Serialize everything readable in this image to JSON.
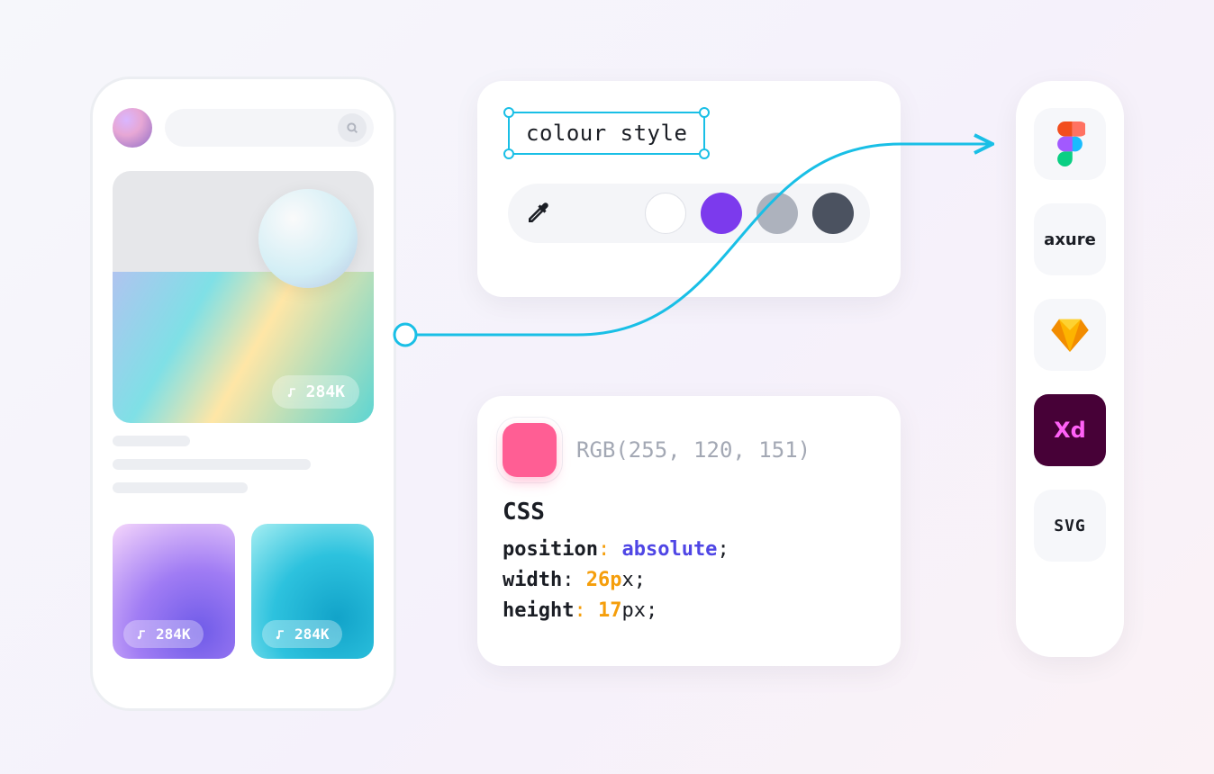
{
  "phone": {
    "hero_count": "284K",
    "thumb1_count": "284K",
    "thumb2_count": "284K"
  },
  "style_panel": {
    "field_label": "colour style",
    "swatches": {
      "white": "#ffffff",
      "violet": "#7c3aed",
      "grey": "#adb2bd",
      "dark": "#4b5260"
    }
  },
  "info_panel": {
    "chip_color": "#ff5e94",
    "rgb_label": "RGB(255, 120, 151)",
    "css_heading": "CSS",
    "css": {
      "l1_prop": "position",
      "l1_val": "absolute",
      "l2_prop": "width",
      "l2_num": "26p",
      "l2_unit": "x",
      "l3_prop": "height",
      "l3_num": "17",
      "l3_unit": "px"
    }
  },
  "rail": {
    "figma": "Figma",
    "axure": "axure",
    "sketch": "Sketch",
    "xd": "Xd",
    "svg": "SVG"
  }
}
